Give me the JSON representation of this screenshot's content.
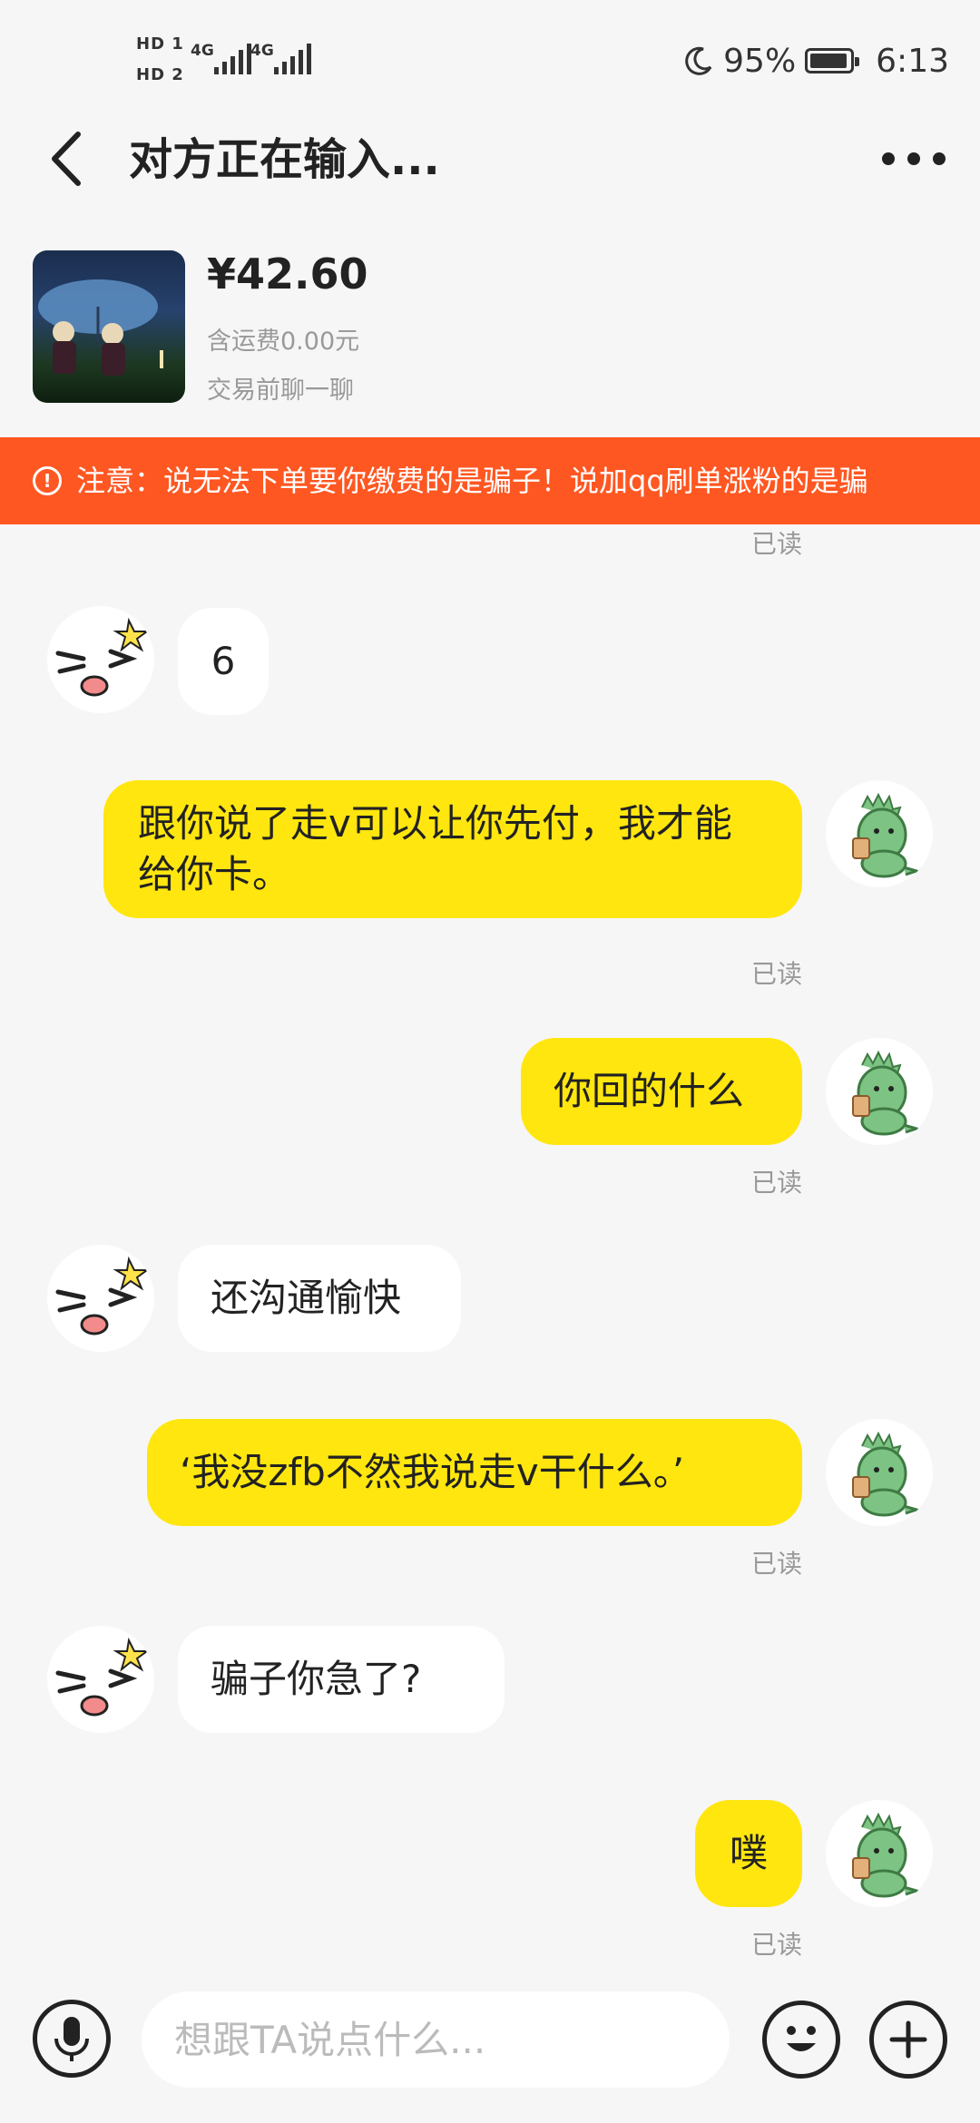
{
  "status_bar": {
    "hd1": "HD 1",
    "hd2": "HD 2",
    "net1": "4G",
    "net2": "4G",
    "battery_percent": "95%",
    "time": "6:13",
    "battery_level": 0.95
  },
  "header": {
    "title": "对方正在输入..."
  },
  "item": {
    "price": "¥42.60",
    "shipping": "含运费0.00元",
    "hint": "交易前聊一聊"
  },
  "warning": {
    "text": "注意：说无法下单要你缴费的是骗子！说加qq刷单涨粉的是骗"
  },
  "read_label": "已读",
  "messages": [
    {
      "side": "in",
      "text": "6"
    },
    {
      "side": "out",
      "text": "跟你说了走v可以让你先付，我才能给你卡。"
    },
    {
      "side": "out",
      "text": "你回的什么"
    },
    {
      "side": "in",
      "text": "还沟通愉快"
    },
    {
      "side": "out",
      "text": "‘我没zfb不然我说走v干什么。’"
    },
    {
      "side": "in",
      "text": "骗子你急了?"
    },
    {
      "side": "out",
      "text": "噗"
    }
  ],
  "composer": {
    "placeholder": "想跟TA说点什么..."
  },
  "icons": {
    "back": "chevron-left-icon",
    "more": "more-dots-icon",
    "warning": "alert-circle-icon",
    "mic": "microphone-icon",
    "emoji": "emoji-icon",
    "plus": "plus-icon",
    "moon": "moon-icon"
  },
  "colors": {
    "accent": "#ffe60f",
    "warning": "#ff5722",
    "background": "#f6f6f6"
  }
}
